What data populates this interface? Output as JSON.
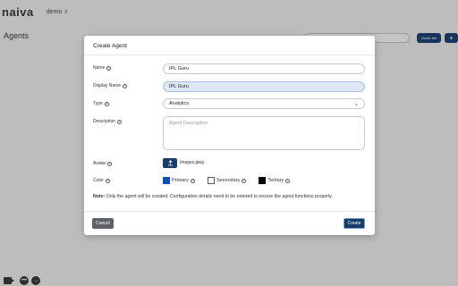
{
  "app": {
    "logo_text": "naiva",
    "workspace": "demo",
    "page_title": "Agents",
    "guide_label": "Guide Me",
    "plus_label": "+"
  },
  "bottom_tools": {
    "more_label": "•••",
    "next_label": "→"
  },
  "modal": {
    "title": "Create Agent",
    "fields": {
      "name": {
        "label": "Name",
        "value": "IPL Guru"
      },
      "display_name": {
        "label": "Display Name",
        "value": "IPL Guru"
      },
      "type": {
        "label": "Type",
        "value": "Analytics"
      },
      "description": {
        "label": "Description",
        "placeholder": "Agent Description"
      },
      "avatar": {
        "label": "Avatar",
        "filename": "images.jpeg"
      },
      "color": {
        "label": "Color",
        "options": [
          {
            "label": "Primary",
            "color": "#0b4fb3"
          },
          {
            "label": "Secondary",
            "color": "#ffffff"
          },
          {
            "label": "Tertiary",
            "color": "#000000"
          }
        ]
      }
    },
    "note_prefix": "Note:",
    "note_text": " Only the agent will be created. Configuration details need to be entered to ensure the agent functions properly.",
    "cancel_label": "Cancel",
    "create_label": "Create"
  },
  "icons": {
    "info": "info-icon",
    "upload": "upload-icon",
    "caret": "chevron-down-icon"
  },
  "colors": {
    "brand": "#153c6c",
    "focus_bg": "#dde7f6"
  }
}
